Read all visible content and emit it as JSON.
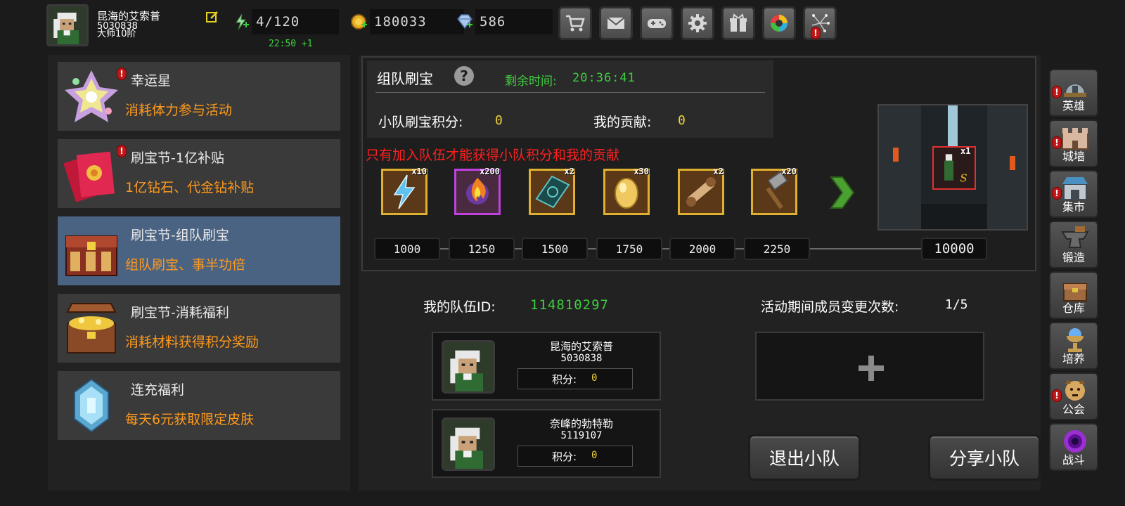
{
  "player": {
    "name": "昆海的艾索普",
    "id": "5030838",
    "rank": "大师10阶",
    "stamina": "4/120",
    "stamina_regen": "22:50 +1",
    "gold": "180033",
    "diamonds": "586"
  },
  "toolbar": {
    "buttons": [
      "cart-icon",
      "mail-icon",
      "gamepad-icon",
      "gear-icon",
      "gift-icon",
      "aperture-icon",
      "firework-icon"
    ]
  },
  "events": [
    {
      "title": "幸运星",
      "desc": "消耗体力参与活动",
      "alert": true
    },
    {
      "title": "刷宝节-1亿补贴",
      "desc": "1亿钻石、代金钻补贴",
      "alert": true
    },
    {
      "title": "刷宝节-组队刷宝",
      "desc": "组队刷宝、事半功倍",
      "alert": false,
      "active": true
    },
    {
      "title": "刷宝节-消耗福利",
      "desc": "消耗材料获得积分奖励",
      "alert": false
    },
    {
      "title": "连充福利",
      "desc": "每天6元获取限定皮肤",
      "alert": false
    }
  ],
  "team_event": {
    "title": "组队刷宝",
    "help": "?",
    "remaining_label": "剩余时间:",
    "remaining_value": "20:36:41",
    "team_score_label": "小队刷宝积分:",
    "team_score_value": "0",
    "contribution_label": "我的贡献:",
    "contribution_value": "0",
    "warning": "只有加入队伍才能获得小队积分和我的贡献",
    "rewards": [
      {
        "icon": "lightning-icon",
        "qty": "x10"
      },
      {
        "icon": "flame-orb-icon",
        "qty": "x200"
      },
      {
        "icon": "spellbook-icon",
        "qty": "x2"
      },
      {
        "icon": "egg-icon",
        "qty": "x30"
      },
      {
        "icon": "scroll-icon",
        "qty": "x2"
      },
      {
        "icon": "hammer-icon",
        "qty": "x20"
      }
    ],
    "milestones": [
      "1000",
      "1250",
      "1500",
      "1750",
      "2000",
      "2250"
    ],
    "final_milestone": "10000",
    "final_reward_qty": "x1"
  },
  "team": {
    "id_label": "我的队伍ID:",
    "id_value": "114810297",
    "changes_label": "活动期间成员变更次数:",
    "changes_value": "1/5",
    "members": [
      {
        "name": "昆海的艾索普",
        "id": "5030838",
        "score_label": "积分:",
        "score": "0"
      },
      {
        "name": "奈峰的勃特勒",
        "id": "5119107",
        "score_label": "积分:",
        "score": "0"
      }
    ],
    "add_symbol": "+",
    "leave_button": "退出小队",
    "share_button": "分享小队"
  },
  "right_nav": [
    {
      "label": "英雄",
      "icon": "helmet-icon",
      "alert": true
    },
    {
      "label": "城墙",
      "icon": "wall-icon",
      "alert": true
    },
    {
      "label": "集市",
      "icon": "market-icon",
      "alert": true
    },
    {
      "label": "锻造",
      "icon": "anvil-icon",
      "alert": false
    },
    {
      "label": "仓库",
      "icon": "warehouse-icon",
      "alert": false
    },
    {
      "label": "培养",
      "icon": "chalice-icon",
      "alert": false
    },
    {
      "label": "公会",
      "icon": "guild-icon",
      "alert": true
    },
    {
      "label": "战斗",
      "icon": "portal-icon",
      "alert": false
    }
  ],
  "colors": {
    "accent_green": "#3ecf3e",
    "accent_orange": "#ff9a1c",
    "accent_gold": "#f0d040",
    "warning_red": "#ff2020",
    "active_tab": "#4b6382"
  }
}
